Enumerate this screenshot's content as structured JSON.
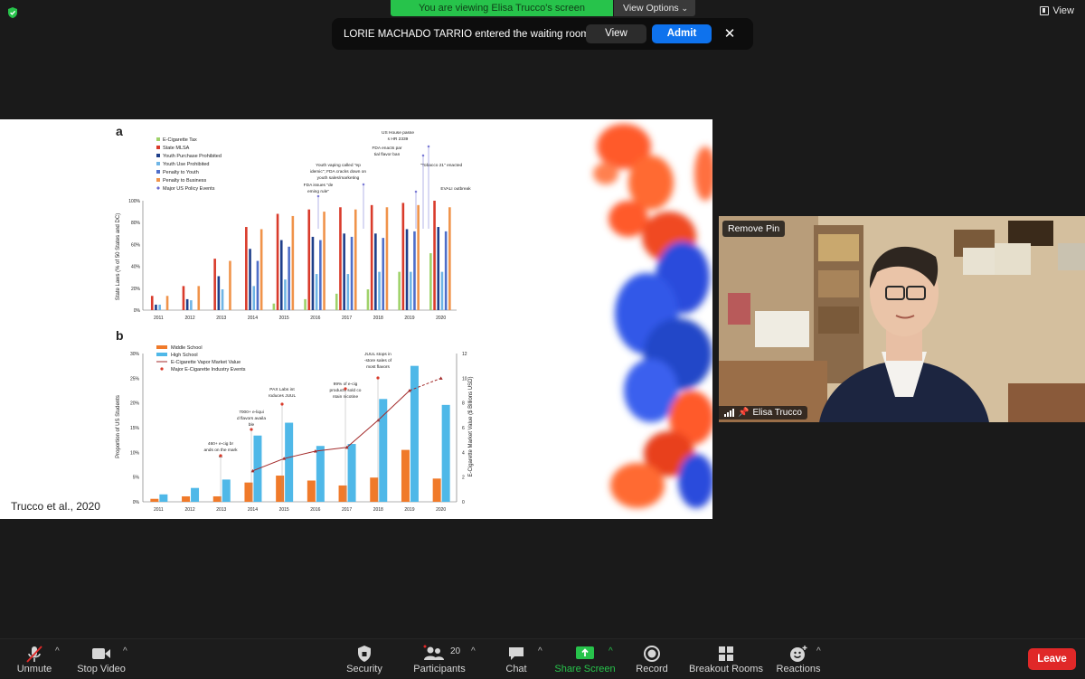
{
  "top_bar": {
    "share_banner": "You are viewing Elisa Trucco's screen",
    "view_options": "View Options",
    "view_label": "View"
  },
  "notification": {
    "text": "LORIE MACHADO TARRIO entered the waiting room",
    "view_button": "View",
    "admit_button": "Admit",
    "close_icon": "close-icon"
  },
  "shared_screen": {
    "citation": "Trucco et al., 2020",
    "panel_a": {
      "label": "a",
      "legend": [
        "E-Cigarette Tax",
        "State MLSA",
        "Youth Purchase Prohibited",
        "Youth Use Prohibited",
        "Penalty to Youth",
        "Penalty to Business",
        "Major US Policy Events"
      ],
      "ylabel": "State Laws (% of 50 States and DC)",
      "yticks": [
        "0%",
        "20%",
        "40%",
        "60%",
        "80%",
        "100%"
      ],
      "xticks": [
        "2011",
        "2012",
        "2013",
        "2014",
        "2015",
        "2016",
        "2017",
        "2018",
        "2019",
        "2020"
      ],
      "annotations": [
        "US House passes HR 2339",
        "FDA enacts partial flavor ban",
        "Youth vaping called \"epidemic\"; FDA cracks down on youth sales/marketing",
        "\"Tobacco 21\" enacted",
        "FDA issues \"deeming rule\"",
        "EVALI outbreak"
      ]
    },
    "panel_b": {
      "label": "b",
      "legend": [
        "Middle School",
        "High School",
        "E-Cigarette Vapor Market Value",
        "Major E-Cigarette Industry Events"
      ],
      "ylabel": "Proportion of US Students",
      "y2label": "E-Cigarette Market Value ($ Billions USD)",
      "yticks": [
        "0%",
        "5%",
        "10%",
        "15%",
        "20%",
        "25%",
        "30%"
      ],
      "y2ticks": [
        "0",
        "2",
        "4",
        "6",
        "8",
        "10",
        "12"
      ],
      "xticks": [
        "2011",
        "2012",
        "2013",
        "2014",
        "2015",
        "2016",
        "2017",
        "2018",
        "2019",
        "2020"
      ],
      "annotations": [
        "JUUL stops in-store sales of most flavors",
        "99% of e-cig products sold contain nicotine",
        "PAX Labs introduces JUUL",
        "7000+ e-liquid flavors available",
        "460+ e-cig brands on the market"
      ]
    }
  },
  "chart_data": [
    {
      "type": "bar",
      "title": "a",
      "ylabel": "State Laws (% of 50 States and DC)",
      "ylim": [
        0,
        100
      ],
      "categories": [
        "2011",
        "2012",
        "2013",
        "2014",
        "2015",
        "2016",
        "2017",
        "2018",
        "2019",
        "2020"
      ],
      "series": [
        {
          "name": "E-Cigarette Tax",
          "color": "#9fd26a",
          "values": [
            0,
            0,
            0,
            0,
            6,
            10,
            15,
            19,
            35,
            52
          ]
        },
        {
          "name": "State MLSA",
          "color": "#d93b2b",
          "values": [
            13,
            22,
            47,
            76,
            88,
            92,
            94,
            96,
            98,
            100
          ]
        },
        {
          "name": "Youth Purchase Prohibited",
          "color": "#1f3f8a",
          "values": [
            5,
            10,
            31,
            56,
            64,
            67,
            70,
            70,
            74,
            76
          ]
        },
        {
          "name": "Youth Use Prohibited",
          "color": "#6fb5e6",
          "values": [
            5,
            9,
            19,
            22,
            28,
            33,
            33,
            35,
            35,
            35
          ]
        },
        {
          "name": "Penalty to Youth",
          "color": "#4f6fc9",
          "values": [
            0,
            0,
            0,
            45,
            58,
            64,
            67,
            66,
            72,
            72
          ]
        },
        {
          "name": "Penalty to Business",
          "color": "#f0934a",
          "values": [
            13,
            22,
            45,
            74,
            86,
            90,
            92,
            94,
            96,
            94
          ]
        }
      ]
    },
    {
      "type": "bar",
      "title": "b",
      "ylabel": "Proportion of US Students",
      "y2label": "E-Cigarette Market Value ($ Billions USD)",
      "ylim": [
        0,
        30
      ],
      "y2lim": [
        0,
        12
      ],
      "categories": [
        "2011",
        "2012",
        "2013",
        "2014",
        "2015",
        "2016",
        "2017",
        "2018",
        "2019",
        "2020"
      ],
      "series": [
        {
          "name": "Middle School",
          "color": "#f07a2a",
          "values": [
            0.6,
            1.1,
            1.1,
            3.9,
            5.3,
            4.3,
            3.3,
            4.9,
            10.5,
            4.7
          ]
        },
        {
          "name": "High School",
          "color": "#4fb8e8",
          "values": [
            1.5,
            2.8,
            4.5,
            13.4,
            16.0,
            11.3,
            11.7,
            20.8,
            27.5,
            19.6
          ]
        },
        {
          "name": "E-Cigarette Vapor Market Value",
          "type": "line",
          "color": "#a32a2a",
          "x": [
            "2014",
            "2015",
            "2016",
            "2017",
            "2018",
            "2019",
            "2020"
          ],
          "values": [
            2.5,
            3.5,
            4.1,
            4.4,
            6.6,
            9.0,
            10.0
          ]
        }
      ]
    }
  ],
  "video_tile": {
    "remove_pin": "Remove Pin",
    "participant_name": "Elisa Trucco"
  },
  "toolbar": {
    "unmute": "Unmute",
    "stop_video": "Stop Video",
    "security": "Security",
    "participants": "Participants",
    "participant_count": "20",
    "chat": "Chat",
    "share_screen": "Share Screen",
    "record": "Record",
    "breakout_rooms": "Breakout Rooms",
    "reactions": "Reactions",
    "leave": "Leave"
  }
}
